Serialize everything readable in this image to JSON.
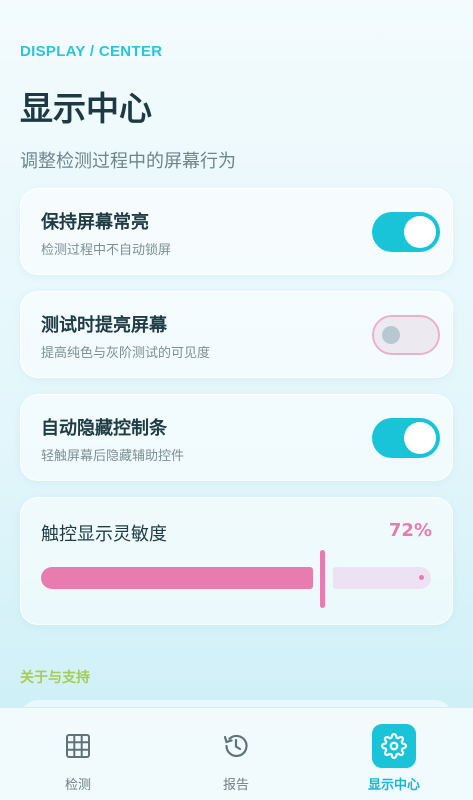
{
  "header": {
    "overline": "DISPLAY / CENTER",
    "title": "显示中心",
    "subtitle": "调整检测过程中的屏幕行为"
  },
  "settings": [
    {
      "label": "保持屏幕常亮",
      "description": "检测过程中不自动锁屏",
      "enabled": true
    },
    {
      "label": "测试时提亮屏幕",
      "description": "提高纯色与灰阶测试的可见度",
      "enabled": false
    },
    {
      "label": "自动隐藏控制条",
      "description": "轻触屏幕后隐藏辅助控件",
      "enabled": true
    }
  ],
  "sensitivity": {
    "label": "触控显示灵敏度",
    "value_text": "72%",
    "value": 72
  },
  "section": {
    "label": "关于与支持"
  },
  "nav": [
    {
      "label": "检测",
      "icon": "grid-icon",
      "active": false
    },
    {
      "label": "报告",
      "icon": "history-icon",
      "active": false
    },
    {
      "label": "显示中心",
      "icon": "gear-icon",
      "active": true
    }
  ],
  "colors": {
    "accent": "#19c3d8",
    "slider": "#e87cae",
    "section_label": "#a6cc58"
  }
}
